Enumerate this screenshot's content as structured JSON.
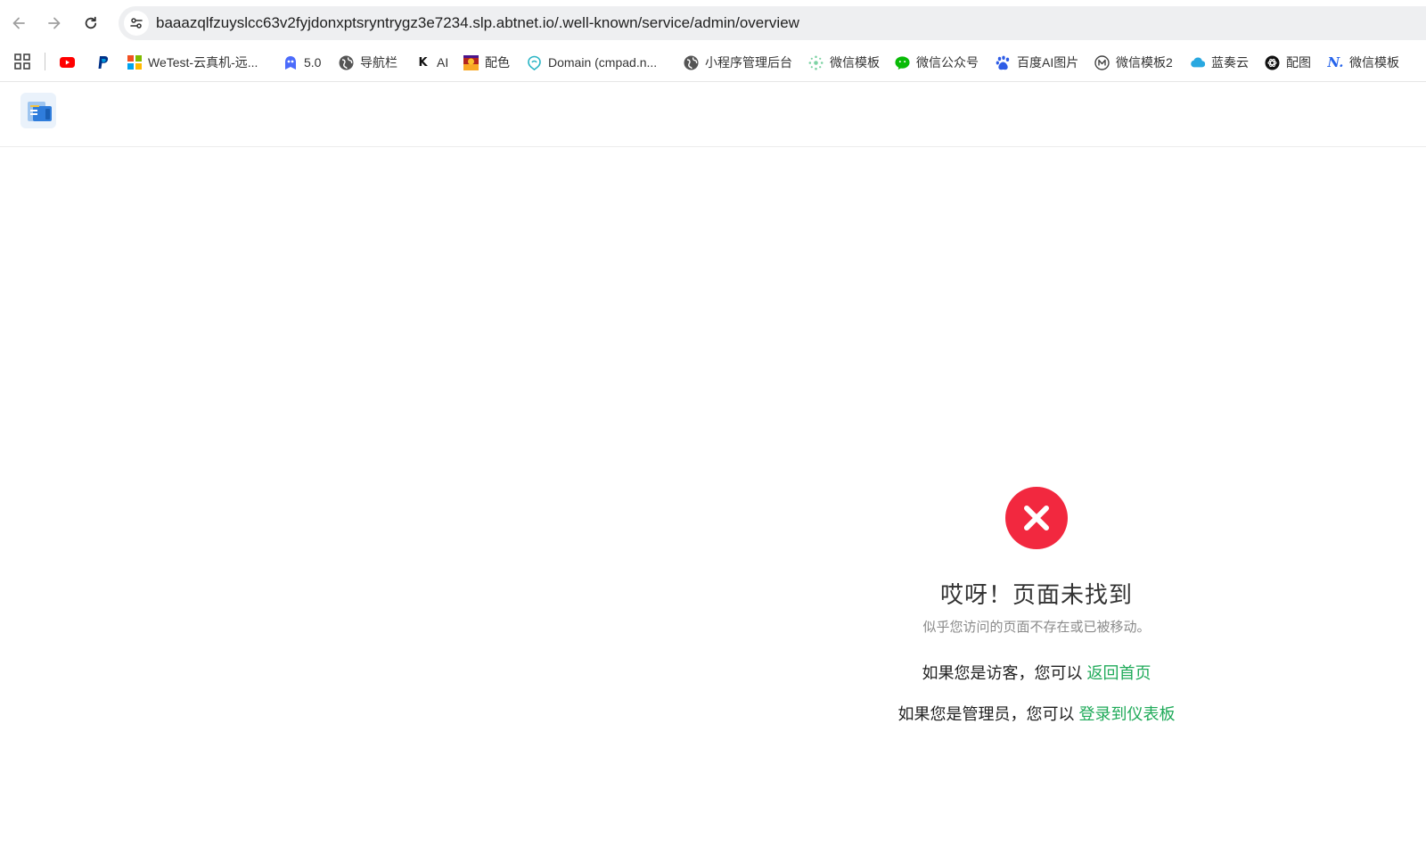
{
  "browser": {
    "url": "baaazqlfzuyslcc63v2fyjdonxptsryntrygz3e7234.slp.abtnet.io/.well-known/service/admin/overview",
    "bookmarks": [
      {
        "label": "",
        "icon": "youtube-icon"
      },
      {
        "label": "",
        "icon": "paypal-icon"
      },
      {
        "label": "WeTest-云真机-远...",
        "icon": "wetest-icon"
      },
      {
        "label": "5.0",
        "icon": "bot-icon"
      },
      {
        "label": "导航栏",
        "icon": "globe-icon"
      },
      {
        "label": "AI",
        "icon": "k-icon"
      },
      {
        "label": "配色",
        "icon": "palette-icon"
      },
      {
        "label": "Domain (cmpad.n...",
        "icon": "domain-icon"
      },
      {
        "label": "小程序管理后台",
        "icon": "globe-icon"
      },
      {
        "label": "微信模板",
        "icon": "dots-icon"
      },
      {
        "label": "微信公众号",
        "icon": "wechat-icon"
      },
      {
        "label": "百度AI图片",
        "icon": "baidu-icon"
      },
      {
        "label": "微信模板2",
        "icon": "m-icon"
      },
      {
        "label": "蓝奏云",
        "icon": "cloud-icon"
      },
      {
        "label": "配图",
        "icon": "openai-icon"
      },
      {
        "label": "微信模板",
        "icon": "n-icon"
      }
    ]
  },
  "error": {
    "title": "哎呀！页面未找到",
    "description": "似乎您访问的页面不存在或已被移动。",
    "visitor_prefix": "如果您是访客，您可以",
    "visitor_link": "返回首页",
    "admin_prefix": "如果您是管理员，您可以",
    "admin_link": "登录到仪表板"
  },
  "colors": {
    "error_red": "#f2283f",
    "link_green": "#1faa59"
  }
}
